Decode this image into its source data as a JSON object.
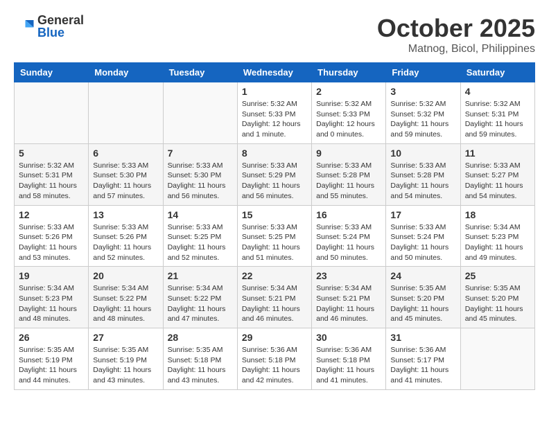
{
  "header": {
    "logo": {
      "general": "General",
      "blue": "Blue"
    },
    "title": "October 2025",
    "location": "Matnog, Bicol, Philippines"
  },
  "weekdays": [
    "Sunday",
    "Monday",
    "Tuesday",
    "Wednesday",
    "Thursday",
    "Friday",
    "Saturday"
  ],
  "weeks": [
    [
      {
        "day": null,
        "info": null
      },
      {
        "day": null,
        "info": null
      },
      {
        "day": null,
        "info": null
      },
      {
        "day": "1",
        "info": "Sunrise: 5:32 AM\nSunset: 5:33 PM\nDaylight: 12 hours\nand 1 minute."
      },
      {
        "day": "2",
        "info": "Sunrise: 5:32 AM\nSunset: 5:33 PM\nDaylight: 12 hours\nand 0 minutes."
      },
      {
        "day": "3",
        "info": "Sunrise: 5:32 AM\nSunset: 5:32 PM\nDaylight: 11 hours\nand 59 minutes."
      },
      {
        "day": "4",
        "info": "Sunrise: 5:32 AM\nSunset: 5:31 PM\nDaylight: 11 hours\nand 59 minutes."
      }
    ],
    [
      {
        "day": "5",
        "info": "Sunrise: 5:32 AM\nSunset: 5:31 PM\nDaylight: 11 hours\nand 58 minutes."
      },
      {
        "day": "6",
        "info": "Sunrise: 5:33 AM\nSunset: 5:30 PM\nDaylight: 11 hours\nand 57 minutes."
      },
      {
        "day": "7",
        "info": "Sunrise: 5:33 AM\nSunset: 5:30 PM\nDaylight: 11 hours\nand 56 minutes."
      },
      {
        "day": "8",
        "info": "Sunrise: 5:33 AM\nSunset: 5:29 PM\nDaylight: 11 hours\nand 56 minutes."
      },
      {
        "day": "9",
        "info": "Sunrise: 5:33 AM\nSunset: 5:28 PM\nDaylight: 11 hours\nand 55 minutes."
      },
      {
        "day": "10",
        "info": "Sunrise: 5:33 AM\nSunset: 5:28 PM\nDaylight: 11 hours\nand 54 minutes."
      },
      {
        "day": "11",
        "info": "Sunrise: 5:33 AM\nSunset: 5:27 PM\nDaylight: 11 hours\nand 54 minutes."
      }
    ],
    [
      {
        "day": "12",
        "info": "Sunrise: 5:33 AM\nSunset: 5:26 PM\nDaylight: 11 hours\nand 53 minutes."
      },
      {
        "day": "13",
        "info": "Sunrise: 5:33 AM\nSunset: 5:26 PM\nDaylight: 11 hours\nand 52 minutes."
      },
      {
        "day": "14",
        "info": "Sunrise: 5:33 AM\nSunset: 5:25 PM\nDaylight: 11 hours\nand 52 minutes."
      },
      {
        "day": "15",
        "info": "Sunrise: 5:33 AM\nSunset: 5:25 PM\nDaylight: 11 hours\nand 51 minutes."
      },
      {
        "day": "16",
        "info": "Sunrise: 5:33 AM\nSunset: 5:24 PM\nDaylight: 11 hours\nand 50 minutes."
      },
      {
        "day": "17",
        "info": "Sunrise: 5:33 AM\nSunset: 5:24 PM\nDaylight: 11 hours\nand 50 minutes."
      },
      {
        "day": "18",
        "info": "Sunrise: 5:34 AM\nSunset: 5:23 PM\nDaylight: 11 hours\nand 49 minutes."
      }
    ],
    [
      {
        "day": "19",
        "info": "Sunrise: 5:34 AM\nSunset: 5:23 PM\nDaylight: 11 hours\nand 48 minutes."
      },
      {
        "day": "20",
        "info": "Sunrise: 5:34 AM\nSunset: 5:22 PM\nDaylight: 11 hours\nand 48 minutes."
      },
      {
        "day": "21",
        "info": "Sunrise: 5:34 AM\nSunset: 5:22 PM\nDaylight: 11 hours\nand 47 minutes."
      },
      {
        "day": "22",
        "info": "Sunrise: 5:34 AM\nSunset: 5:21 PM\nDaylight: 11 hours\nand 46 minutes."
      },
      {
        "day": "23",
        "info": "Sunrise: 5:34 AM\nSunset: 5:21 PM\nDaylight: 11 hours\nand 46 minutes."
      },
      {
        "day": "24",
        "info": "Sunrise: 5:35 AM\nSunset: 5:20 PM\nDaylight: 11 hours\nand 45 minutes."
      },
      {
        "day": "25",
        "info": "Sunrise: 5:35 AM\nSunset: 5:20 PM\nDaylight: 11 hours\nand 45 minutes."
      }
    ],
    [
      {
        "day": "26",
        "info": "Sunrise: 5:35 AM\nSunset: 5:19 PM\nDaylight: 11 hours\nand 44 minutes."
      },
      {
        "day": "27",
        "info": "Sunrise: 5:35 AM\nSunset: 5:19 PM\nDaylight: 11 hours\nand 43 minutes."
      },
      {
        "day": "28",
        "info": "Sunrise: 5:35 AM\nSunset: 5:18 PM\nDaylight: 11 hours\nand 43 minutes."
      },
      {
        "day": "29",
        "info": "Sunrise: 5:36 AM\nSunset: 5:18 PM\nDaylight: 11 hours\nand 42 minutes."
      },
      {
        "day": "30",
        "info": "Sunrise: 5:36 AM\nSunset: 5:18 PM\nDaylight: 11 hours\nand 41 minutes."
      },
      {
        "day": "31",
        "info": "Sunrise: 5:36 AM\nSunset: 5:17 PM\nDaylight: 11 hours\nand 41 minutes."
      },
      {
        "day": null,
        "info": null
      }
    ]
  ]
}
